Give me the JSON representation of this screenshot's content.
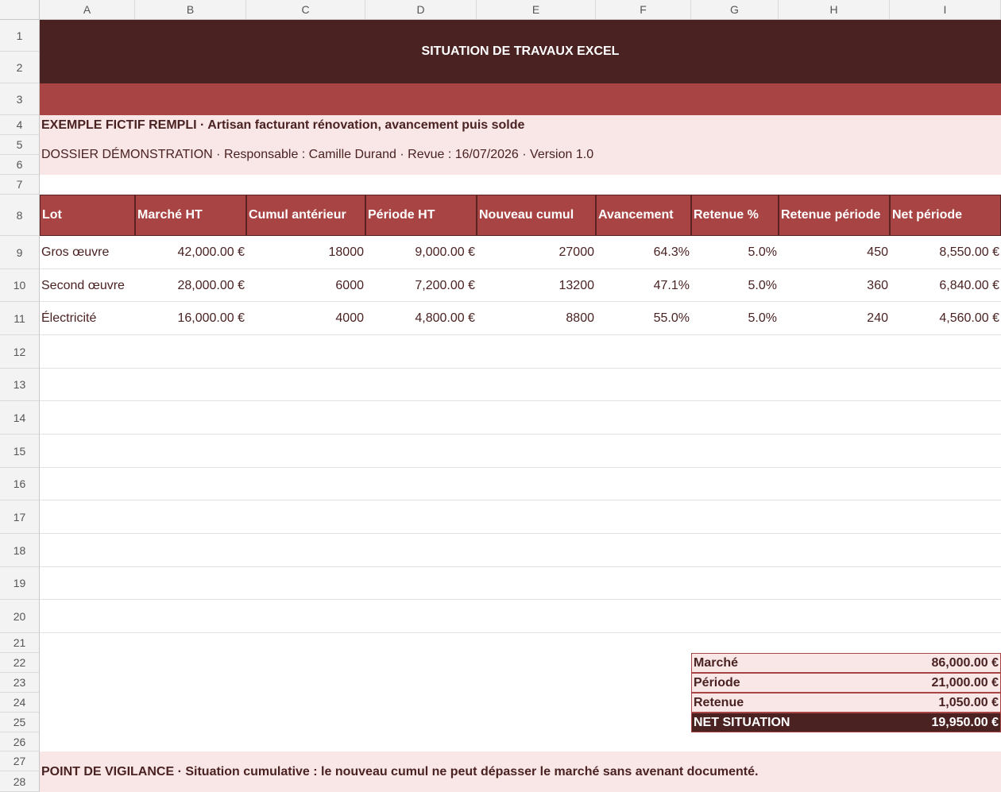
{
  "columns": [
    "A",
    "B",
    "C",
    "D",
    "E",
    "F",
    "G",
    "H",
    "I"
  ],
  "rows": [
    "1",
    "2",
    "3",
    "4",
    "5",
    "6",
    "7",
    "8",
    "9",
    "10",
    "11",
    "12",
    "13",
    "14",
    "15",
    "16",
    "17",
    "18",
    "19",
    "20",
    "21",
    "22",
    "23",
    "24",
    "25",
    "26",
    "27",
    "28"
  ],
  "title": "SITUATION DE TRAVAUX EXCEL",
  "subtitle_bold": "EXEMPLE FICTIF REMPLI · Artisan facturant rénovation, avancement puis solde",
  "info_line": "DOSSIER DÉMONSTRATION · Responsable : Camille Durand · Revue : 16/07/2026 · Version 1.0",
  "table": {
    "headers": [
      "Lot",
      "Marché HT",
      "Cumul antérieur",
      "Période HT",
      "Nouveau cumul",
      "Avancement",
      "Retenue %",
      "Retenue période",
      "Net période"
    ],
    "rows": [
      [
        "Gros œuvre",
        "42,000.00 €",
        "18000",
        "9,000.00 €",
        "27000",
        "64.3%",
        "5.0%",
        "450",
        "8,550.00 €"
      ],
      [
        "Second œuvre",
        "28,000.00 €",
        "6000",
        "7,200.00 €",
        "13200",
        "47.1%",
        "5.0%",
        "360",
        "6,840.00 €"
      ],
      [
        "Électricité",
        "16,000.00 €",
        "4000",
        "4,800.00 €",
        "8800",
        "55.0%",
        "5.0%",
        "240",
        "4,560.00 €"
      ]
    ]
  },
  "summary": [
    {
      "label": "Marché",
      "value": "86,000.00 €"
    },
    {
      "label": "Période",
      "value": "21,000.00 €"
    },
    {
      "label": "Retenue",
      "value": "1,050.00 €"
    },
    {
      "label": "NET SITUATION",
      "value": "19,950.00 €"
    }
  ],
  "footer_note": "POINT DE VIGILANCE · Situation cumulative : le nouveau cumul ne peut dépasser le marché sans avenant documenté.",
  "colors": {
    "title_bg": "#4a2222",
    "accent": "#a84444",
    "light": "#f9e6e6",
    "text": "#4a2222"
  }
}
